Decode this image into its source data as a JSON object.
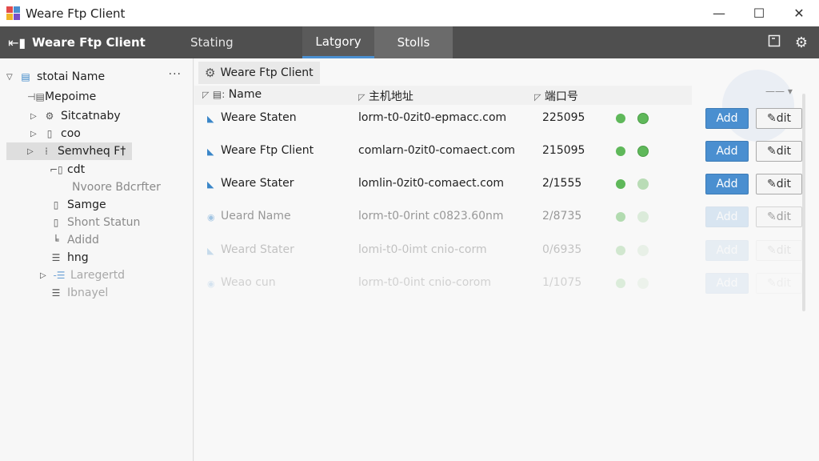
{
  "window": {
    "title": "Weare Ftp Client",
    "controls": {
      "minimize": "—",
      "maximize": "☐",
      "close": "✕"
    }
  },
  "toolbar": {
    "app_title": "Weare Ftp Client",
    "menu_item": "Stating",
    "tabs": [
      {
        "label": "Latgory",
        "active": true
      },
      {
        "label": "Stolls",
        "active": false
      }
    ],
    "icons": [
      "window-icon",
      "gear-icon"
    ]
  },
  "tree": {
    "header": "stotai Name",
    "more": "···",
    "items": [
      {
        "label": "Mepoime",
        "icon": "server-icon"
      },
      {
        "label": "Sitcatnaby",
        "icon": "gear-icon"
      },
      {
        "label": "coo",
        "icon": "file-icon"
      },
      {
        "label": "Semvheq F†",
        "icon": "server-icon",
        "selected": true
      },
      {
        "label": "cdt",
        "icon": "folder-icon"
      },
      {
        "label": "Nvoore Bdcrfter",
        "icon": ""
      },
      {
        "label": "Samge",
        "icon": "file-icon"
      },
      {
        "label": "Shont Statun",
        "icon": "file-icon"
      },
      {
        "label": "Adidd",
        "icon": "chart-icon"
      },
      {
        "label": "hng",
        "icon": "list-icon"
      },
      {
        "label": "Laregertd",
        "icon": "list-icon"
      },
      {
        "label": "Ibnayel",
        "icon": "list-icon"
      }
    ]
  },
  "main": {
    "panel_title": "Weare Ftp Client",
    "columns": {
      "name": "Name",
      "host": "主机地址",
      "port": "端口号"
    },
    "rows": [
      {
        "name": "Weare Staten",
        "host": "lorm-t0-0zit0-epmacc.com",
        "port": "225095",
        "add": "Add",
        "edit": "dit"
      },
      {
        "name": "Weare Ftp Client",
        "host": "comlarn-0zit0-comaect.com",
        "port": "215095",
        "add": "Add",
        "edit": "dit"
      },
      {
        "name": "Weare Stater",
        "host": "lomlin-0zit0-comaect.com",
        "port": "2/1555",
        "add": "Add",
        "edit": "dit"
      },
      {
        "name": "Ueard Name",
        "host": "lorm-t0-0rint c0823.60nm",
        "port": "2/8735",
        "add": "Add",
        "edit": "dit"
      },
      {
        "name": "Weard Stater",
        "host": "lomi-t0-0imt cnio-corm",
        "port": "0/6935",
        "add": "Add",
        "edit": "dit"
      },
      {
        "name": "Weao cun",
        "host": "lorm-t0-0int cnio-corom",
        "port": "1/1075",
        "add": "Add",
        "edit": "dit"
      }
    ]
  },
  "colors": {
    "accent": "#4a8fd0",
    "toolbar_bg": "#4f4f4f",
    "status_green": "#5fb85a"
  }
}
